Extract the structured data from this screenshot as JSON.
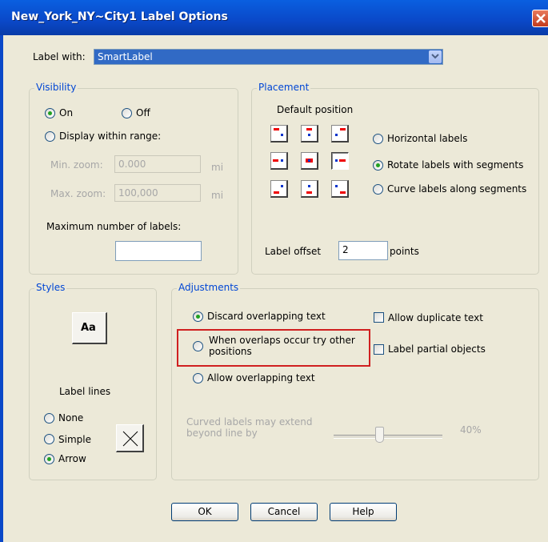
{
  "window": {
    "title": "New_York_NY~City1 Label Options"
  },
  "label_with": {
    "label": "Label with:",
    "value": "SmartLabel"
  },
  "visibility": {
    "title": "Visibility",
    "on_label": "On",
    "off_label": "Off",
    "range_label": "Display within range:",
    "min_zoom_label": "Min. zoom:",
    "min_zoom_value": "0.000",
    "min_zoom_unit": "mi",
    "max_zoom_label": "Max. zoom:",
    "max_zoom_value": "100,000",
    "max_zoom_unit": "mi",
    "max_labels_label": "Maximum number of labels:",
    "max_labels_value": ""
  },
  "placement": {
    "title": "Placement",
    "default_position_label": "Default position",
    "horizontal_label": "Horizontal labels",
    "rotate_label": "Rotate labels with segments",
    "curve_label": "Curve labels along segments",
    "offset_label": "Label offset",
    "offset_value": "2",
    "offset_unit": "points"
  },
  "styles": {
    "title": "Styles",
    "style_button_label": "Aa",
    "label_lines_title": "Label lines",
    "none_label": "None",
    "simple_label": "Simple",
    "arrow_label": "Arrow"
  },
  "adjustments": {
    "title": "Adjustments",
    "discard_label": "Discard overlapping text",
    "try_other_line1": "When overlaps occur try other",
    "try_other_line2": "positions",
    "allow_overlap_label": "Allow overlapping text",
    "allow_duplicate_label": "Allow duplicate text",
    "label_partial_label": "Label partial objects",
    "curved_line1": "Curved labels may extend",
    "curved_line2": "beyond line by",
    "curved_value": "40%"
  },
  "buttons": {
    "ok": "OK",
    "cancel": "Cancel",
    "help": "Help"
  },
  "colors": {
    "title_bar": "#0a48c8",
    "group_title": "#0046d5",
    "highlight": "#d02020",
    "selection": "#316ac5"
  }
}
